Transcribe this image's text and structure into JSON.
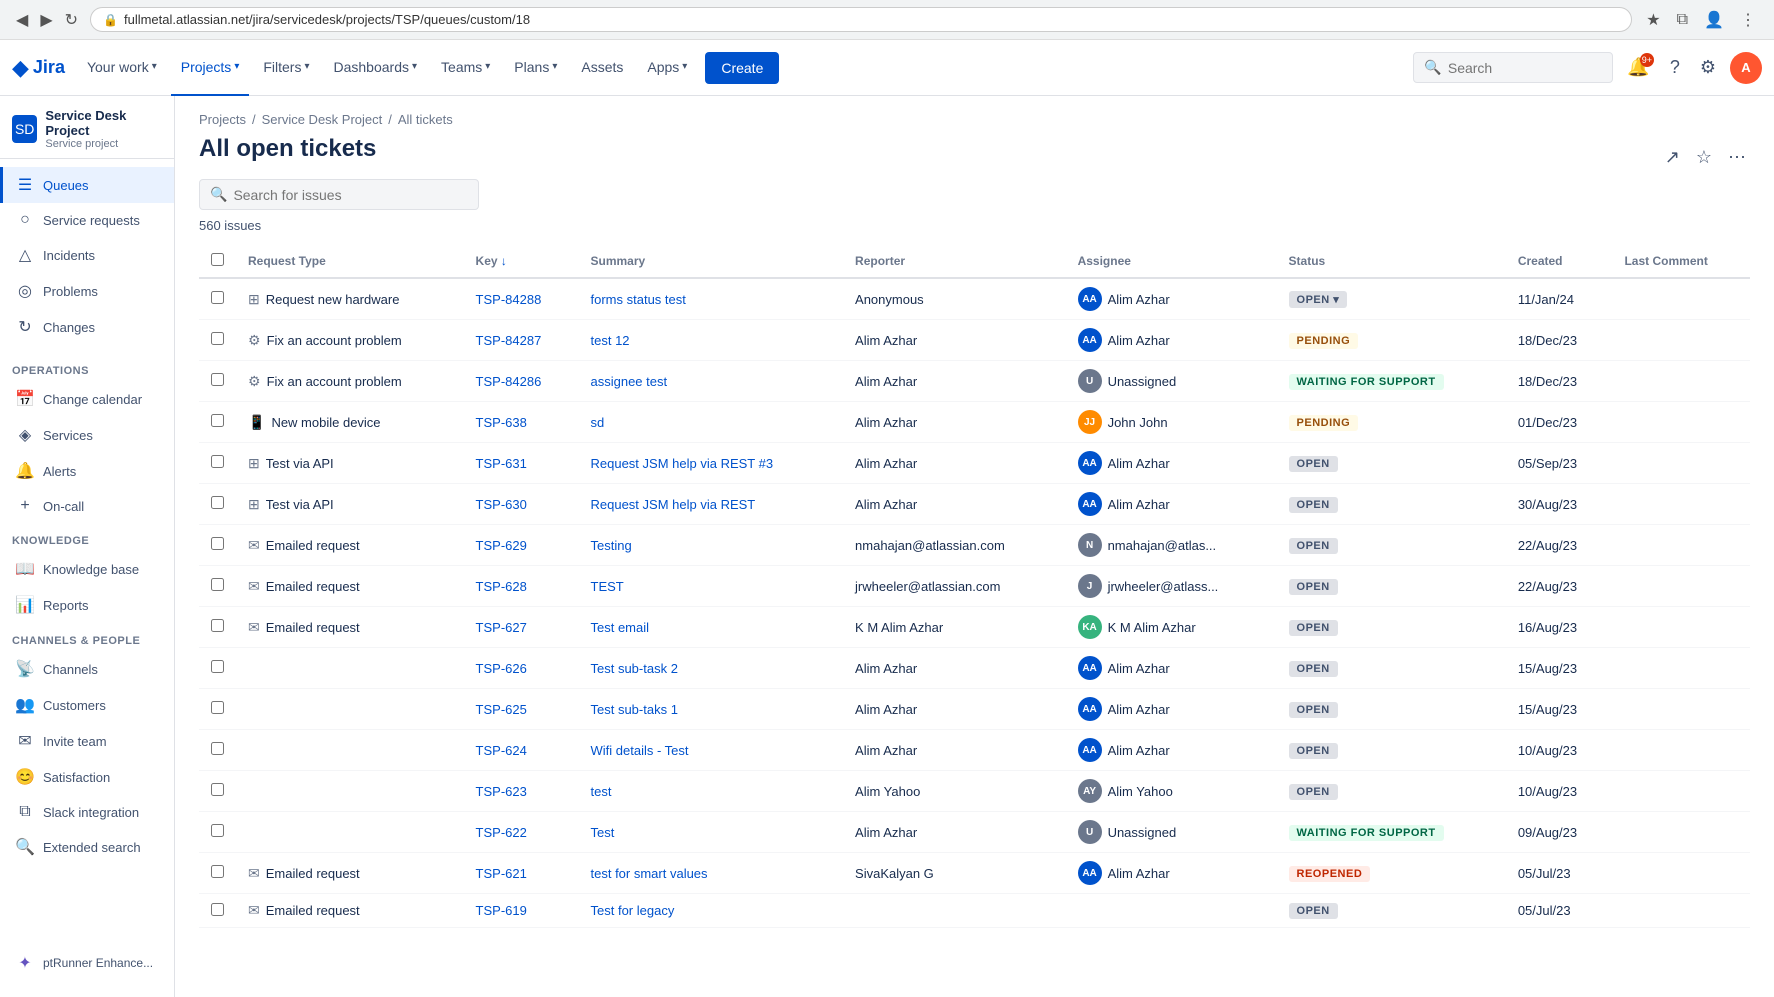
{
  "browser": {
    "url": "fullmetal.atlassian.net/jira/servicedesk/projects/TSP/queues/custom/18",
    "back_btn": "◀",
    "forward_btn": "▶",
    "reload_btn": "↻"
  },
  "topnav": {
    "logo_text": "Jira",
    "nav_items": [
      {
        "label": "Your work",
        "id": "your-work"
      },
      {
        "label": "Projects",
        "id": "projects",
        "active": true
      },
      {
        "label": "Filters",
        "id": "filters"
      },
      {
        "label": "Dashboards",
        "id": "dashboards"
      },
      {
        "label": "Teams",
        "id": "teams"
      },
      {
        "label": "Plans",
        "id": "plans"
      },
      {
        "label": "Assets",
        "id": "assets"
      },
      {
        "label": "Apps",
        "id": "apps"
      }
    ],
    "create_label": "Create",
    "search_placeholder": "Search",
    "notification_count": "9+"
  },
  "sidebar": {
    "project_name": "Service Desk Project",
    "project_type": "Service project",
    "nav_items": [
      {
        "label": "Queues",
        "icon": "☰",
        "id": "queues",
        "active": true
      },
      {
        "label": "Service requests",
        "icon": "○",
        "id": "service-requests"
      },
      {
        "label": "Incidents",
        "icon": "△",
        "id": "incidents"
      },
      {
        "label": "Problems",
        "icon": "◎",
        "id": "problems"
      },
      {
        "label": "Changes",
        "icon": "↻",
        "id": "changes"
      }
    ],
    "sections": [
      {
        "label": "OPERATIONS",
        "items": [
          {
            "label": "Change calendar",
            "icon": "📅",
            "id": "change-calendar"
          },
          {
            "label": "Services",
            "icon": "◈",
            "id": "services"
          },
          {
            "label": "Alerts",
            "icon": "🔔",
            "id": "alerts"
          },
          {
            "label": "On-call",
            "icon": "+",
            "id": "on-call"
          }
        ]
      },
      {
        "label": "KNOWLEDGE",
        "items": [
          {
            "label": "Knowledge base",
            "icon": "📖",
            "id": "knowledge-base"
          },
          {
            "label": "Reports",
            "icon": "📊",
            "id": "reports"
          }
        ]
      },
      {
        "label": "CHANNELS & PEOPLE",
        "items": [
          {
            "label": "Channels",
            "icon": "📡",
            "id": "channels"
          },
          {
            "label": "Customers",
            "icon": "👥",
            "id": "customers"
          },
          {
            "label": "Invite team",
            "icon": "✉",
            "id": "invite-team"
          }
        ]
      },
      {
        "label": "",
        "items": [
          {
            "label": "Satisfaction",
            "icon": "😊",
            "id": "satisfaction"
          },
          {
            "label": "Slack integration",
            "icon": "⧉",
            "id": "slack-integration"
          },
          {
            "label": "Extended search",
            "icon": "🔍",
            "id": "extended-search"
          }
        ]
      }
    ],
    "bottom_item": {
      "label": "ptRunner Enhance...",
      "icon": "✦",
      "id": "ptrunner"
    }
  },
  "breadcrumb": {
    "items": [
      "Projects",
      "Service Desk Project",
      "All tickets"
    ]
  },
  "page": {
    "title": "All open tickets",
    "issue_count": "560 issues",
    "search_placeholder": "Search for issues"
  },
  "table": {
    "columns": [
      "Request Type",
      "Key ↓",
      "Summary",
      "Reporter",
      "Assignee",
      "Status",
      "Created",
      "Last Comment"
    ],
    "rows": [
      {
        "request_type": "Request new hardware",
        "rt_icon": "⊞",
        "key": "TSP-84288",
        "summary": "forms status test",
        "reporter": "Anonymous",
        "assignee": "Alim Azhar",
        "assignee_color": "#0052CC",
        "assignee_initials": "AA",
        "status": "OPEN",
        "status_type": "open",
        "status_extra": "▾",
        "created": "11/Jan/24"
      },
      {
        "request_type": "Fix an account problem",
        "rt_icon": "⚙",
        "key": "TSP-84287",
        "summary": "test 12",
        "reporter": "Alim Azhar",
        "assignee": "Alim Azhar",
        "assignee_color": "#0052CC",
        "assignee_initials": "AA",
        "status": "PENDING",
        "status_type": "pending",
        "created": "18/Dec/23"
      },
      {
        "request_type": "Fix an account problem",
        "rt_icon": "⚙",
        "key": "TSP-84286",
        "summary": "assignee test",
        "reporter": "Alim Azhar",
        "assignee": "Unassigned",
        "assignee_color": "#6B778C",
        "assignee_initials": "?",
        "status": "WAITING FOR SUPPORT",
        "status_type": "waiting",
        "created": "18/Dec/23"
      },
      {
        "request_type": "New mobile device",
        "rt_icon": "📱",
        "key": "TSP-638",
        "summary": "sd",
        "reporter": "Alim Azhar",
        "assignee": "John John",
        "assignee_color": "#FF8B00",
        "assignee_initials": "JJ",
        "status": "PENDING",
        "status_type": "pending",
        "created": "01/Dec/23"
      },
      {
        "request_type": "Test via API",
        "rt_icon": "⊞",
        "key": "TSP-631",
        "summary": "Request JSM help via REST #3",
        "reporter": "Alim Azhar",
        "assignee": "Alim Azhar",
        "assignee_color": "#0052CC",
        "assignee_initials": "AA",
        "status": "OPEN",
        "status_type": "open",
        "created": "05/Sep/23"
      },
      {
        "request_type": "Test via API",
        "rt_icon": "⊞",
        "key": "TSP-630",
        "summary": "Request JSM help via REST",
        "reporter": "Alim Azhar",
        "assignee": "Alim Azhar",
        "assignee_color": "#0052CC",
        "assignee_initials": "AA",
        "status": "OPEN",
        "status_type": "open",
        "created": "30/Aug/23"
      },
      {
        "request_type": "Emailed request",
        "rt_icon": "✉",
        "key": "TSP-629",
        "summary": "Testing",
        "reporter": "nmahajan@atlassian.com",
        "assignee": "nmahajan@atlas...",
        "assignee_color": "#6B778C",
        "assignee_initials": "N",
        "status": "OPEN",
        "status_type": "open",
        "created": "22/Aug/23"
      },
      {
        "request_type": "Emailed request",
        "rt_icon": "✉",
        "key": "TSP-628",
        "summary": "TEST",
        "reporter": "jrwheeler@atlassian.com",
        "assignee": "jrwheeler@atlass...",
        "assignee_color": "#6B778C",
        "assignee_initials": "J",
        "status": "OPEN",
        "status_type": "open",
        "created": "22/Aug/23"
      },
      {
        "request_type": "Emailed request",
        "rt_icon": "✉",
        "key": "TSP-627",
        "summary": "Test email",
        "reporter": "K M Alim Azhar",
        "assignee": "K M Alim Azhar",
        "assignee_color": "#36B37E",
        "assignee_initials": "KA",
        "status": "OPEN",
        "status_type": "open",
        "created": "16/Aug/23"
      },
      {
        "request_type": "",
        "rt_icon": "",
        "key": "TSP-626",
        "summary": "Test sub-task 2",
        "reporter": "Alim Azhar",
        "assignee": "Alim Azhar",
        "assignee_color": "#0052CC",
        "assignee_initials": "AA",
        "status": "OPEN",
        "status_type": "open",
        "created": "15/Aug/23"
      },
      {
        "request_type": "",
        "rt_icon": "",
        "key": "TSP-625",
        "summary": "Test sub-taks 1",
        "reporter": "Alim Azhar",
        "assignee": "Alim Azhar",
        "assignee_color": "#0052CC",
        "assignee_initials": "AA",
        "status": "OPEN",
        "status_type": "open",
        "created": "15/Aug/23"
      },
      {
        "request_type": "",
        "rt_icon": "",
        "key": "TSP-624",
        "summary": "Wifi details - Test",
        "reporter": "Alim Azhar",
        "assignee": "Alim Azhar",
        "assignee_color": "#0052CC",
        "assignee_initials": "AA",
        "status": "OPEN",
        "status_type": "open",
        "created": "10/Aug/23"
      },
      {
        "request_type": "",
        "rt_icon": "",
        "key": "TSP-623",
        "summary": "test",
        "reporter": "Alim Yahoo",
        "assignee": "Alim Yahoo",
        "assignee_color": "#6B778C",
        "assignee_initials": "AY",
        "status": "OPEN",
        "status_type": "open",
        "created": "10/Aug/23"
      },
      {
        "request_type": "",
        "rt_icon": "",
        "key": "TSP-622",
        "summary": "Test",
        "reporter": "Alim Azhar",
        "assignee": "Unassigned",
        "assignee_color": "#6B778C",
        "assignee_initials": "?",
        "status": "WAITING FOR SUPPORT",
        "status_type": "waiting",
        "created": "09/Aug/23"
      },
      {
        "request_type": "Emailed request",
        "rt_icon": "✉",
        "key": "TSP-621",
        "summary": "test for smart values",
        "reporter": "SivaKalyan G",
        "assignee": "Alim Azhar",
        "assignee_color": "#0052CC",
        "assignee_initials": "AA",
        "status": "REOPENED",
        "status_type": "reopened",
        "created": "05/Jul/23"
      },
      {
        "request_type": "Emailed request",
        "rt_icon": "✉",
        "key": "TSP-619",
        "summary": "Test for legacy",
        "reporter": "",
        "assignee": "",
        "assignee_color": "#6B778C",
        "assignee_initials": "",
        "status": "OPEN",
        "status_type": "open",
        "created": "05/Jul/23"
      }
    ]
  }
}
